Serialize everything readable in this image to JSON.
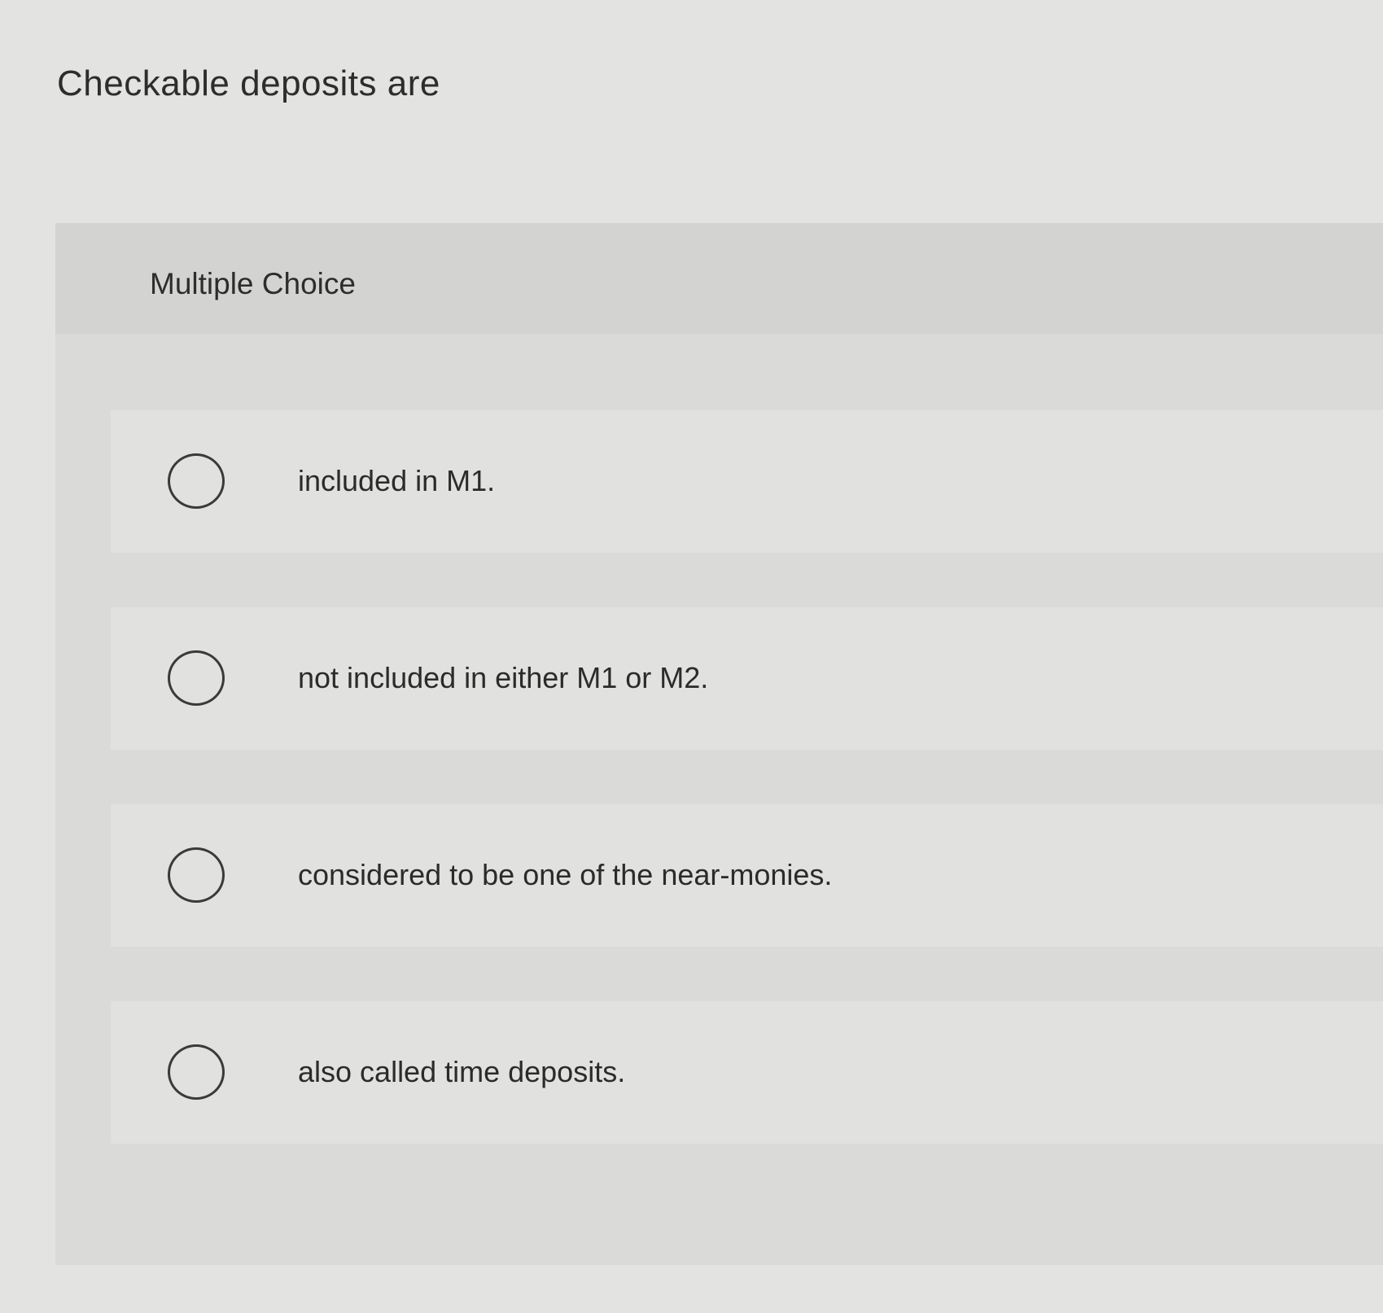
{
  "question": {
    "text": "Checkable deposits are"
  },
  "choice_block": {
    "header": "Multiple Choice",
    "options": [
      {
        "label": "included in M1.",
        "selected": false
      },
      {
        "label": "not included in either M1 or M2.",
        "selected": false
      },
      {
        "label": "considered to be one of the near-monies.",
        "selected": false
      },
      {
        "label": "also called time deposits.",
        "selected": false
      }
    ]
  }
}
